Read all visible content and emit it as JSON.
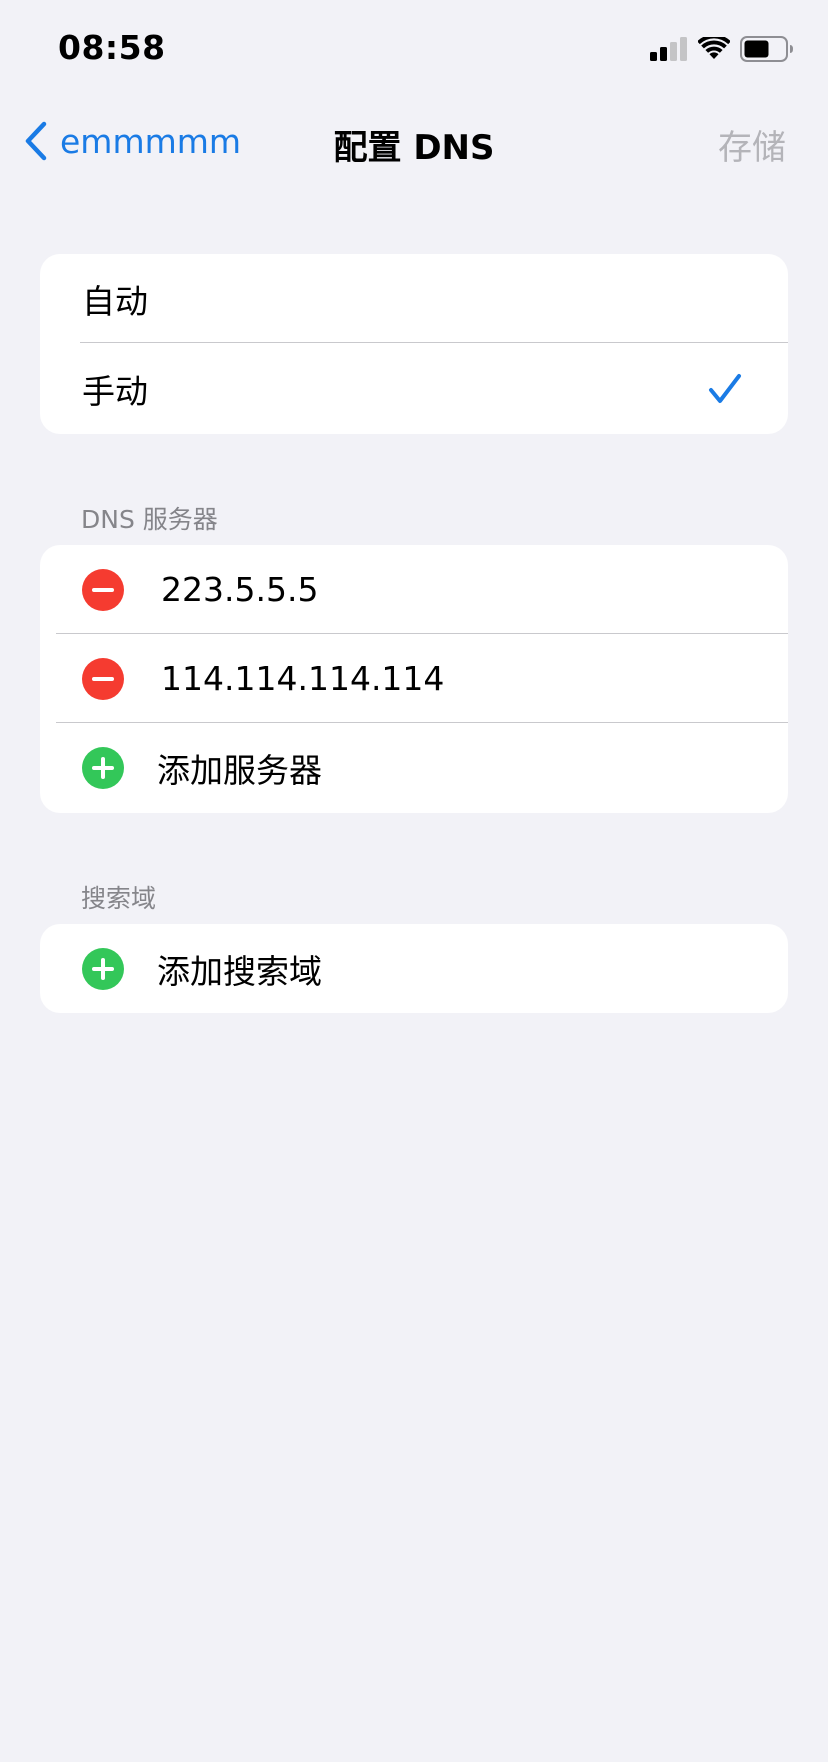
{
  "status_bar": {
    "time": "08:58",
    "icons": [
      "cellular-signal-icon",
      "wifi-icon",
      "battery-icon"
    ]
  },
  "nav": {
    "back_label": "emmmmm",
    "title": "配置 DNS",
    "save_label": "存储",
    "back_icon": "chevron-left-icon"
  },
  "mode_group": {
    "options": [
      {
        "label": "自动",
        "selected": false
      },
      {
        "label": "手动",
        "selected": true
      }
    ]
  },
  "dns_section": {
    "header": "DNS 服务器",
    "servers": [
      "223.5.5.5",
      "114.114.114.114"
    ],
    "add_label": "添加服务器"
  },
  "search_section": {
    "header": "搜索域",
    "add_label": "添加搜索域"
  },
  "colors": {
    "accent": "#1a7be5",
    "remove": "#f53b30",
    "add": "#33c759",
    "background": "#f2f2f7",
    "disabled": "#b4b4b9"
  }
}
